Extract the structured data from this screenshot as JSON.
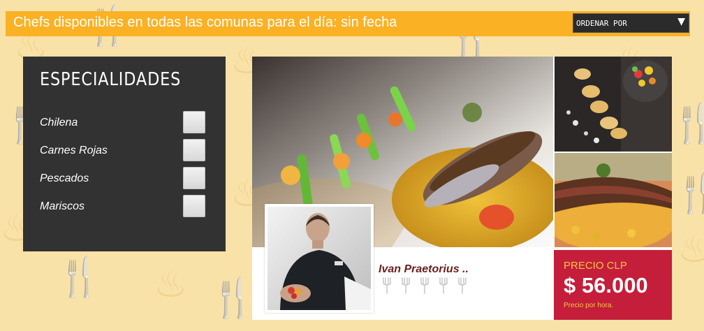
{
  "header": {
    "title": "Chefs disponibles en todas las comunas para el día: sin fecha",
    "sort_label": "ORDENAR POR",
    "sort_arrow": "▼"
  },
  "filters": {
    "title": "ESPECIALIDADES",
    "items": [
      {
        "label": "Chilena",
        "checked": false
      },
      {
        "label": "Carnes Rojas",
        "checked": false
      },
      {
        "label": "Pescados",
        "checked": false
      },
      {
        "label": "Mariscos",
        "checked": false
      }
    ]
  },
  "chef_card": {
    "name": "Ivan Praetorius ..",
    "rating_icons": 5,
    "price_label": "PRECIO CLP",
    "price_value": "$ 56.000",
    "price_note": "Precio por hora."
  },
  "colors": {
    "header_bg": "#fbb124",
    "panel_bg": "#323232",
    "price_bg": "#c41e3a",
    "price_accent": "#f4c542",
    "chef_name": "#6b1e1e"
  },
  "icons": {
    "sort": "chevron-down-icon",
    "rating": "fork-icon"
  }
}
